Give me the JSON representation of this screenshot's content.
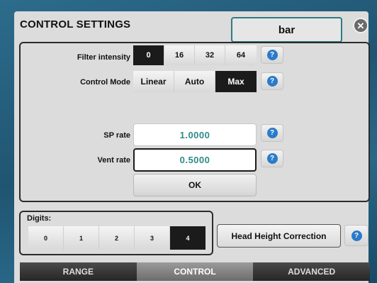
{
  "header": {
    "title": "CONTROL SETTINGS",
    "unit_button": "bar",
    "close_icon": "close-icon"
  },
  "filter": {
    "label": "Filter intensity",
    "options": [
      "0",
      "16",
      "32",
      "64"
    ],
    "selected": "0",
    "help": "?"
  },
  "control_mode": {
    "label": "Control Mode",
    "options": [
      "Linear",
      "Auto",
      "Max"
    ],
    "selected": "Max",
    "help": "?"
  },
  "sp_rate": {
    "label": "SP rate",
    "value": "1.0000",
    "help": "?"
  },
  "vent_rate": {
    "label": "Vent rate",
    "value": "0.5000",
    "help": "?"
  },
  "ok_label": "OK",
  "digits": {
    "label": "Digits:",
    "options": [
      "0",
      "1",
      "2",
      "3",
      "4"
    ],
    "selected": "4"
  },
  "head_height": {
    "label": "Head Height Correction",
    "help": "?"
  },
  "tabs": [
    {
      "label": "RANGE",
      "active": false
    },
    {
      "label": "CONTROL",
      "active": true
    },
    {
      "label": "ADVANCED",
      "active": false
    }
  ],
  "colors": {
    "accent": "#2f7c84",
    "selected": "#1b1b1b",
    "help_blue": "#2a7bc9",
    "value_text": "#2f8a8a"
  }
}
